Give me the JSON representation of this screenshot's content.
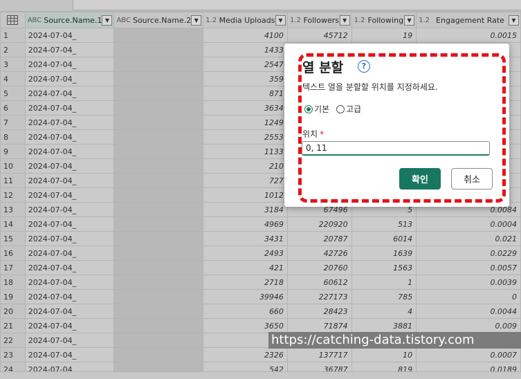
{
  "grid": {
    "columns": [
      {
        "type_icon": "ABC",
        "name": "Source.Name.1"
      },
      {
        "type_icon": "ABC",
        "name": "Source.Name.2"
      },
      {
        "type_icon": "1.2",
        "name": "Media Uploads"
      },
      {
        "type_icon": "1.2",
        "name": "Followers"
      },
      {
        "type_icon": "1.2",
        "name": "Following"
      },
      {
        "type_icon": "1.2",
        "name": "Engagement Rate"
      }
    ],
    "rows": [
      {
        "n": "1",
        "src1": "2024-07-04_",
        "media": "4100",
        "followers": "45712",
        "following": "19",
        "eng": "0.0015"
      },
      {
        "n": "2",
        "src1": "2024-07-04_",
        "media": "1433",
        "followers": "",
        "following": "",
        "eng": ""
      },
      {
        "n": "3",
        "src1": "2024-07-04_",
        "media": "2547",
        "followers": "",
        "following": "",
        "eng": ""
      },
      {
        "n": "4",
        "src1": "2024-07-04_",
        "media": "359",
        "followers": "",
        "following": "",
        "eng": ""
      },
      {
        "n": "5",
        "src1": "2024-07-04_",
        "media": "871",
        "followers": "",
        "following": "",
        "eng": ""
      },
      {
        "n": "6",
        "src1": "2024-07-04_",
        "media": "3634",
        "followers": "",
        "following": "",
        "eng": ""
      },
      {
        "n": "7",
        "src1": "2024-07-04_",
        "media": "1249",
        "followers": "",
        "following": "",
        "eng": ""
      },
      {
        "n": "8",
        "src1": "2024-07-04_",
        "media": "2553",
        "followers": "",
        "following": "",
        "eng": ""
      },
      {
        "n": "9",
        "src1": "2024-07-04_",
        "media": "1133",
        "followers": "",
        "following": "",
        "eng": ""
      },
      {
        "n": "10",
        "src1": "2024-07-04_",
        "media": "210",
        "followers": "",
        "following": "",
        "eng": ""
      },
      {
        "n": "11",
        "src1": "2024-07-04_",
        "media": "727",
        "followers": "",
        "following": "",
        "eng": ""
      },
      {
        "n": "12",
        "src1": "2024-07-04_",
        "media": "1012",
        "followers": "",
        "following": "",
        "eng": ""
      },
      {
        "n": "13",
        "src1": "2024-07-04_",
        "media": "3184",
        "followers": "67496",
        "following": "5",
        "eng": "0.0084"
      },
      {
        "n": "14",
        "src1": "2024-07-04_",
        "media": "4969",
        "followers": "220920",
        "following": "513",
        "eng": "0.0004"
      },
      {
        "n": "15",
        "src1": "2024-07-04_",
        "media": "3431",
        "followers": "20787",
        "following": "6014",
        "eng": "0.021"
      },
      {
        "n": "16",
        "src1": "2024-07-04_",
        "media": "2493",
        "followers": "42726",
        "following": "1639",
        "eng": "0.0229"
      },
      {
        "n": "17",
        "src1": "2024-07-04_",
        "media": "421",
        "followers": "20760",
        "following": "1563",
        "eng": "0.0057"
      },
      {
        "n": "18",
        "src1": "2024-07-04_",
        "media": "2718",
        "followers": "60612",
        "following": "1",
        "eng": "0.0039"
      },
      {
        "n": "19",
        "src1": "2024-07-04_",
        "media": "39946",
        "followers": "227173",
        "following": "785",
        "eng": "0"
      },
      {
        "n": "20",
        "src1": "2024-07-04_",
        "media": "660",
        "followers": "28423",
        "following": "4",
        "eng": "0.0044"
      },
      {
        "n": "21",
        "src1": "2024-07-04_",
        "media": "3650",
        "followers": "71874",
        "following": "3881",
        "eng": "0.009"
      },
      {
        "n": "22",
        "src1": "2024-07-04_",
        "media": "",
        "followers": "",
        "following": "",
        "eng": ""
      },
      {
        "n": "23",
        "src1": "2024-07-04_",
        "media": "2326",
        "followers": "137717",
        "following": "10",
        "eng": "0.0007"
      },
      {
        "n": "24",
        "src1": "2024-07-04_",
        "media": "542",
        "followers": "36787",
        "following": "819",
        "eng": "0.0189"
      }
    ]
  },
  "dialog": {
    "title": "열 분할",
    "help_icon": "help-circle-icon",
    "description": "텍스트 열을 분할할 위치를 지정하세요.",
    "mode_basic": "기본",
    "mode_advanced": "고급",
    "position_label": "위치",
    "required_mark": "*",
    "position_value": "0, 11",
    "ok_label": "확인",
    "cancel_label": "취소",
    "accent_color": "#187760",
    "highlight_color": "#e4141b"
  },
  "watermark": "https://catching-data.tistory.com"
}
